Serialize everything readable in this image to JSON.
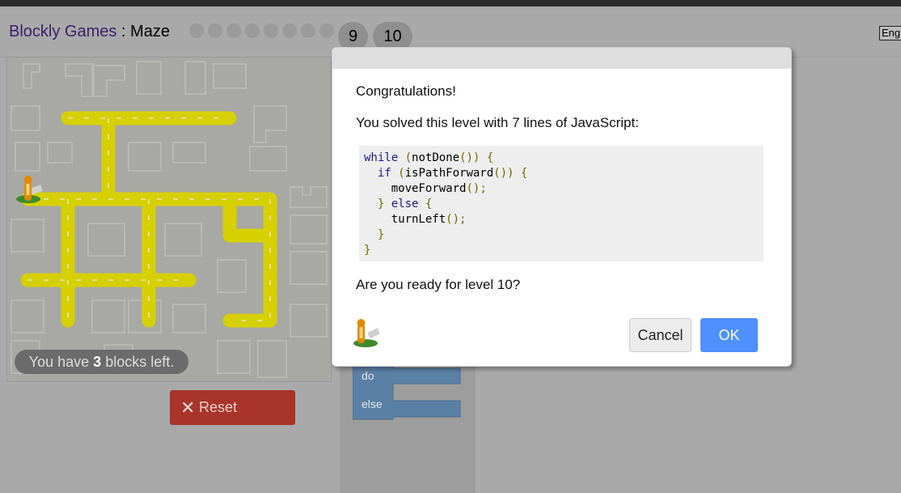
{
  "app": {
    "title_link": "Blockly Games",
    "title_sep": " : ",
    "title_page": "Maze",
    "language": "Eng"
  },
  "levels": {
    "completed": 8,
    "current": "9",
    "next": "10"
  },
  "maze": {
    "blocks_prefix": "You have ",
    "blocks_count": "3",
    "blocks_suffix": " blocks left."
  },
  "reset": {
    "label": "Reset",
    "icon": "close-icon"
  },
  "toolbox": {
    "do_label": "do",
    "else_label": "else"
  },
  "dialog": {
    "heading": "Congratulations!",
    "solved_msg": "You solved this level with 7 lines of JavaScript:",
    "code_lines": [
      "while (notDone()) {",
      "  if (isPathForward()) {",
      "    moveForward();",
      "  } else {",
      "    turnLeft();",
      "  }",
      "}"
    ],
    "next_prompt": "Are you ready for level 10?",
    "cancel_label": "Cancel",
    "ok_label": "OK"
  },
  "colors": {
    "path": "#d6d000",
    "ok_button": "#4d90fe",
    "reset_button": "#a8342a",
    "block": "#5b80a5"
  }
}
